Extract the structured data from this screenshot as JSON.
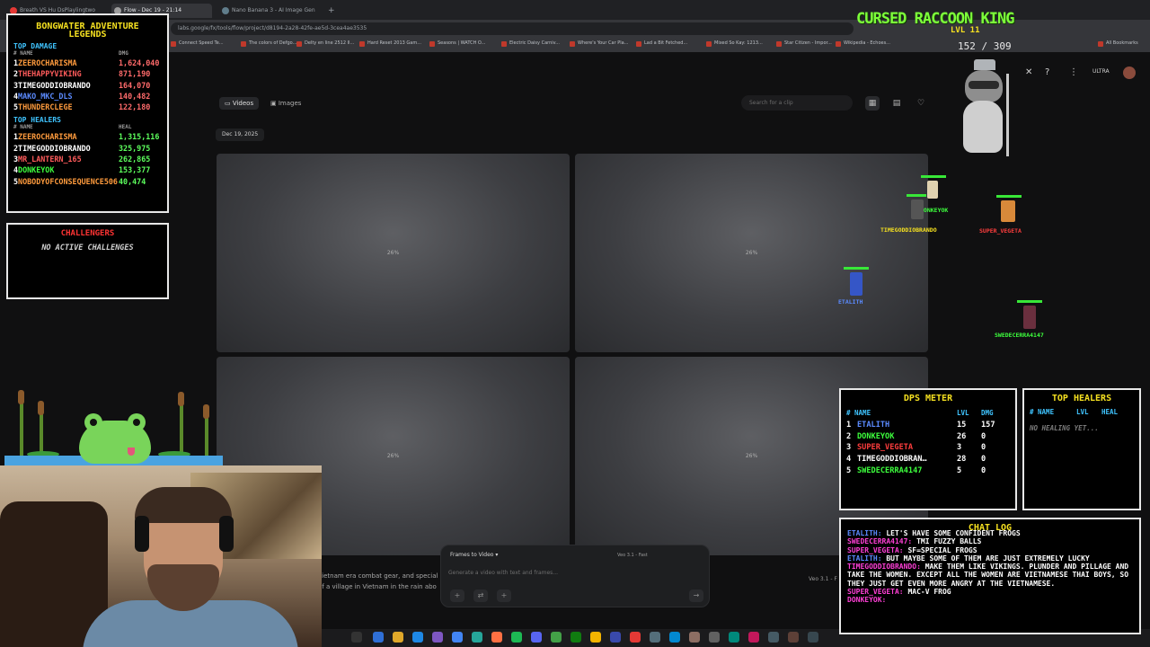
{
  "browser": {
    "tabs": [
      {
        "label": "Breath VS Hu DsPlaylingtwo",
        "color": "#e53935"
      },
      {
        "label": "Flow - Dec 19 - 21:14",
        "color": "#9e9e9e"
      },
      {
        "label": "Nano Banana 3 - AI Image Gen",
        "color": "#607d8b"
      }
    ],
    "url": "labs.google/fx/tools/flow/project/d8194-2a28-42fe-ae5d-3cea4ae3535",
    "bookmarks": [
      "Connect Speed Te...",
      "The colors of Defgo...",
      "Delty en line 2512 II...",
      "Hard Reset 2013 Gam...",
      "Seasons | WATCH O...",
      "Electric Daisy Carniv...",
      "Where's Your Car Pla...",
      "Lad a Bit Fetched...",
      "Mixed So Kay: 1213...",
      "Star Citizen - Impor...",
      "Wikipedia - Echoes...",
      "All Bookmarks"
    ]
  },
  "app": {
    "tabs": [
      "Videos",
      "Images"
    ],
    "search_placeholder": "Search for a clip",
    "date_label": "Dec 19, 2025",
    "tiles": [
      "26%",
      "26%",
      "26%",
      "26%"
    ],
    "prompt_text": "vietnam era combat gear, and special of a village in Vietnam in the rain abo",
    "model_right": "Veo 3.1 - F",
    "composer": {
      "mode": "Frames to Video",
      "model": "Veo 3.1 - Fast",
      "placeholder": "Generate a video with text and frames..."
    },
    "account_badge": "ULTRA"
  },
  "leaderboard": {
    "title_line1": "BONGWATER ADVENTURE",
    "title_line2": "LEGENDS",
    "damage_title": "TOP DAMAGE",
    "damage_col_name": "# NAME",
    "damage_col_val": "DMG",
    "damage": [
      {
        "rank": "1",
        "name": "ZEEROCHARISMA",
        "value": "1,624,040",
        "color": "#ff9b3d"
      },
      {
        "rank": "2",
        "name": "THEHAPPYVIKING",
        "value": "871,190",
        "color": "#ff5b5b"
      },
      {
        "rank": "3",
        "name": "TIMEGODDIOBRANDO",
        "value": "164,070",
        "color": "#ffffff"
      },
      {
        "rank": "4",
        "name": "MAKO_MKC_DLS",
        "value": "140,482",
        "color": "#5b8bff"
      },
      {
        "rank": "5",
        "name": "THUNDERCLEGE",
        "value": "122,180",
        "color": "#ff9b3d"
      }
    ],
    "heal_title": "TOP HEALERS",
    "heal_col_name": "# NAME",
    "heal_col_val": "HEAL",
    "heal": [
      {
        "rank": "1",
        "name": "ZEEROCHARISMA",
        "value": "1,315,116",
        "color": "#ff9b3d"
      },
      {
        "rank": "2",
        "name": "TIMEGODDIOBRANDO",
        "value": "325,975",
        "color": "#ffffff"
      },
      {
        "rank": "3",
        "name": "MR_LANTERN_165",
        "value": "262,865",
        "color": "#ff5b5b"
      },
      {
        "rank": "4",
        "name": "DONKEYOK",
        "value": "153,377",
        "color": "#3dff3d"
      },
      {
        "rank": "5",
        "name": "NOBODYOFCONSEQUENCE506",
        "value": "40,474",
        "color": "#ff9b3d"
      }
    ]
  },
  "challengers": {
    "title": "CHALLENGERS",
    "status": "NO ACTIVE CHALLENGES"
  },
  "game": {
    "boss_name": "CURSED RACCOON KING",
    "boss_level": "LVL 11",
    "boss_hp": "152 / 309",
    "characters": [
      {
        "name": "DONKEYOK",
        "color": "#3dff3d"
      },
      {
        "name": "TIMEGODDIOBRANDO",
        "color": "#f5e020"
      },
      {
        "name": "SUPER_VEGETA",
        "color": "#ff3d3d"
      },
      {
        "name": "ETALITH",
        "color": "#5b8bff"
      },
      {
        "name": "SWEDECERRA4147",
        "color": "#3dff3d"
      }
    ]
  },
  "dps_meter": {
    "title": "DPS METER",
    "col_name": "# NAME",
    "col_lvl": "LVL",
    "col_dmg": "DMG",
    "rows": [
      {
        "rank": "1",
        "name": "ETALITH",
        "lvl": "15",
        "dmg": "157",
        "color": "#5b8bff"
      },
      {
        "rank": "2",
        "name": "DONKEYOK",
        "lvl": "26",
        "dmg": "0",
        "color": "#3dff3d"
      },
      {
        "rank": "3",
        "name": "SUPER_VEGETA",
        "lvl": "3",
        "dmg": "0",
        "color": "#ff3d3d"
      },
      {
        "rank": "4",
        "name": "TIMEGODDIOBRAN…",
        "lvl": "28",
        "dmg": "0",
        "color": "#ffffff"
      },
      {
        "rank": "5",
        "name": "SWEDECERRA4147",
        "lvl": "5",
        "dmg": "0",
        "color": "#3dff3d"
      }
    ]
  },
  "top_healers_panel": {
    "title": "TOP HEALERS",
    "col_name": "# NAME",
    "col_lvl": "LVL",
    "col_heal": "HEAL",
    "empty": "NO HEALING YET..."
  },
  "chat_log": {
    "title": "CHAT LOG",
    "lines": [
      {
        "user": "ETALITH:",
        "text": "LET'S HAVE SOME CONFIDENT FROGS",
        "ucolor": "#5b8bff"
      },
      {
        "user": "SWEDECERRA4147:",
        "text": "TMI FUZZY BALLS",
        "ucolor": "#ff3fd6"
      },
      {
        "user": "SUPER_VEGETA:",
        "text": "SF=SPECIAL FROGS",
        "ucolor": "#ff3fd6"
      },
      {
        "user": "ETALITH:",
        "text": "BUT MAYBE SOME OF THEM ARE JUST EXTREMELY LUCKY",
        "ucolor": "#5b8bff"
      },
      {
        "user": "TIMEGODDIOBRANDO:",
        "text": "MAKE THEM LIKE VIKINGS. PLUNDER AND PILLAGE AND TAKE THE WOMEN. EXCEPT ALL THE WOMEN ARE VIETNAMESE THAI BOYS, SO THEY JUST GET EVEN MORE ANGRY AT THE VIETNAMESE.",
        "ucolor": "#ff3fd6"
      },
      {
        "user": "SUPER_VEGETA:",
        "text": "MAC-V FROG",
        "ucolor": "#ff3fd6"
      },
      {
        "user": "DONKEYOK:",
        "text": "",
        "ucolor": "#ff3fd6"
      }
    ]
  }
}
